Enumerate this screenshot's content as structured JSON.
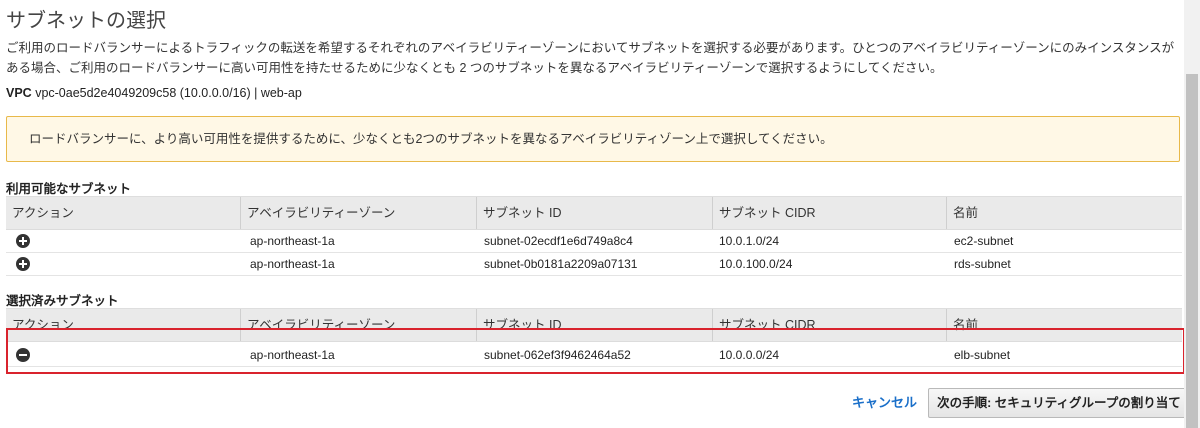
{
  "page": {
    "title": "サブネットの選択",
    "description": "ご利用のロードバランサーによるトラフィックの転送を希望するそれぞれのアベイラビリティーゾーンにおいてサブネットを選択する必要があります。ひとつのアベイラビリティーゾーンにのみインスタンスがある場合、ご利用のロードバランサーに高い可用性を持たせるために少なくとも 2 つのサブネットを異なるアベイラビリティーゾーンで選択するようにしてください。",
    "vpc_label": "VPC",
    "vpc_value": "vpc-0ae5d2e4049209c58 (10.0.0.0/16) | web-ap"
  },
  "alert": {
    "text": "ロードバランサーに、より高い可用性を提供するために、少なくとも2つのサブネットを異なるアベイラビリティゾーン上で選択してください。"
  },
  "columns": [
    "アクション",
    "アベイラビリティーゾーン",
    "サブネット ID",
    "サブネット CIDR",
    "名前"
  ],
  "available": {
    "title": "利用可能なサブネット",
    "rows": [
      {
        "action_icon": "plus-circle-icon",
        "az": "ap-northeast-1a",
        "subnet_id": "subnet-02ecdf1e6d749a8c4",
        "cidr": "10.0.1.0/24",
        "name": "ec2-subnet"
      },
      {
        "action_icon": "plus-circle-icon",
        "az": "ap-northeast-1a",
        "subnet_id": "subnet-0b0181a2209a07131",
        "cidr": "10.0.100.0/24",
        "name": "rds-subnet"
      }
    ]
  },
  "selected": {
    "title": "選択済みサブネット",
    "rows": [
      {
        "action_icon": "minus-circle-icon",
        "az": "ap-northeast-1a",
        "subnet_id": "subnet-062ef3f9462464a52",
        "cidr": "10.0.0.0/24",
        "name": "elb-subnet"
      }
    ]
  },
  "footer": {
    "cancel_label": "キャンセル",
    "next_label": "次の手順: セキュリティグループの割り当て"
  },
  "colors": {
    "highlight": "#d9232d",
    "link": "#1a6fc9",
    "alert_border": "#e8b94a",
    "alert_bg": "#fff8e6"
  }
}
